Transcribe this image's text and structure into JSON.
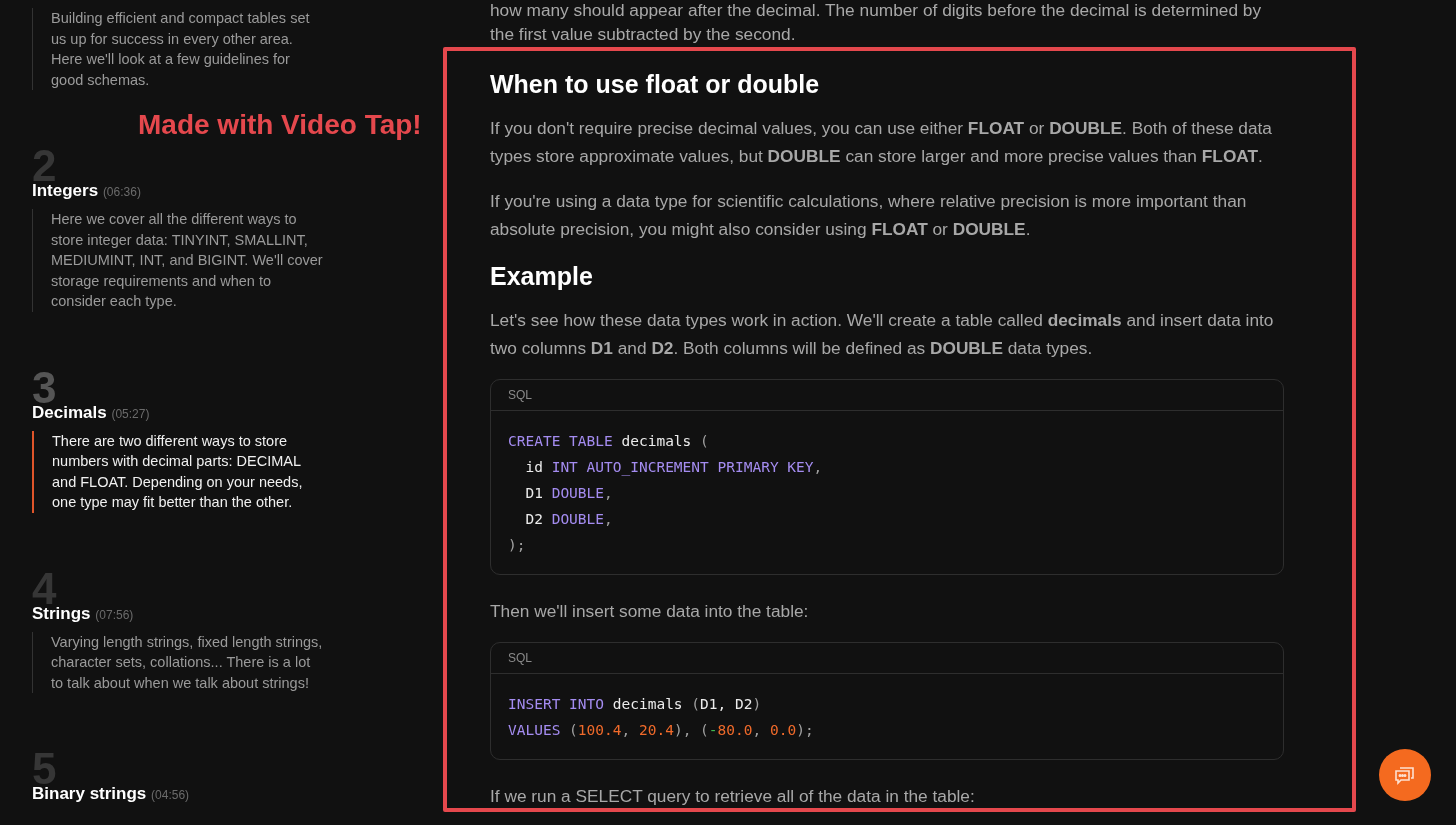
{
  "chapters": [
    {
      "description": "Building efficient and compact tables set us up for success in every other area. Here we'll look at a few guidelines for good schemas.",
      "selected": false
    },
    {
      "number": "2",
      "title": "Integers",
      "time": "(06:36)",
      "description": "Here we cover all the different ways to store integer data: TINYINT, SMALLINT, MEDIUMINT, INT, and BIGINT. We'll cover storage requirements and when to consider each type.",
      "selected": false
    },
    {
      "number": "3",
      "title": "Decimals",
      "time": "(05:27)",
      "description": "There are two different ways to store numbers with decimal parts: DECIMAL and FLOAT. Depending on your needs, one type may fit better than the other.",
      "selected": true
    },
    {
      "number": "4",
      "title": "Strings",
      "time": "(07:56)",
      "description": "Varying length strings, fixed length strings, character sets, collations... There is a lot to talk about when we talk about strings!",
      "selected": false
    },
    {
      "number": "5",
      "title": "Binary strings",
      "time": "(04:56)",
      "selected": false
    }
  ],
  "article": [
    {
      "kind": "paragraph",
      "text": "how many should appear after the decimal. The number of digits before the decimal is determined by the first value subtracted by the second."
    },
    {
      "kind": "heading",
      "text": "When to use float or double"
    },
    {
      "kind": "paragraph",
      "text": "If you don't require precise decimal values, you can use either **FLOAT** or **DOUBLE**. Both of these data types store approximate values, but **DOUBLE** can store larger and more precise values than **FLOAT**."
    },
    {
      "kind": "paragraph",
      "text": "If you're using a data type for scientific calculations, where relative precision is more important than absolute precision, you might also consider using **FLOAT** or **DOUBLE**."
    },
    {
      "kind": "heading",
      "text": "Example"
    },
    {
      "kind": "paragraph",
      "text": "Let's see how these data types work in action. We'll create a table called **decimals** and insert data into two columns **D1** and **D2**. Both columns will be defined as **DOUBLE** data types."
    },
    {
      "kind": "code",
      "language": "SQL",
      "lines": [
        [
          {
            "kind": "keyword",
            "text": "CREATE TABLE"
          },
          {
            "kind": "plain",
            "text": " decimals "
          },
          {
            "kind": "punct",
            "text": "("
          }
        ],
        [
          {
            "kind": "plain",
            "text": "  id "
          },
          {
            "kind": "keyword",
            "text": "INT AUTO_INCREMENT PRIMARY KEY"
          },
          {
            "kind": "punct",
            "text": ","
          }
        ],
        [
          {
            "kind": "plain",
            "text": "  D1 "
          },
          {
            "kind": "keyword",
            "text": "DOUBLE"
          },
          {
            "kind": "punct",
            "text": ","
          }
        ],
        [
          {
            "kind": "plain",
            "text": "  D2 "
          },
          {
            "kind": "keyword",
            "text": "DOUBLE"
          },
          {
            "kind": "punct",
            "text": ","
          }
        ],
        [
          {
            "kind": "punct",
            "text": ");"
          }
        ]
      ]
    },
    {
      "kind": "paragraph",
      "text": "Then we'll insert some data into the table:"
    },
    {
      "kind": "code",
      "language": "SQL",
      "lines": [
        [
          {
            "kind": "keyword",
            "text": "INSERT INTO"
          },
          {
            "kind": "plain",
            "text": " decimals "
          },
          {
            "kind": "punct",
            "text": "("
          },
          {
            "kind": "plain",
            "text": "D1, D2"
          },
          {
            "kind": "punct",
            "text": ")"
          }
        ],
        [
          {
            "kind": "keyword",
            "text": "VALUES"
          },
          {
            "kind": "punct",
            "text": " ("
          },
          {
            "kind": "number",
            "text": "100.4"
          },
          {
            "kind": "punct",
            "text": ", "
          },
          {
            "kind": "number",
            "text": "20.4"
          },
          {
            "kind": "punct",
            "text": "), ("
          },
          {
            "kind": "operator",
            "text": "-"
          },
          {
            "kind": "number",
            "text": "80.0"
          },
          {
            "kind": "punct",
            "text": ", "
          },
          {
            "kind": "number",
            "text": "0.0"
          },
          {
            "kind": "punct",
            "text": ");"
          }
        ]
      ]
    },
    {
      "kind": "paragraph",
      "text": "If we run a SELECT query to retrieve all of the data in the table:"
    }
  ],
  "annotation": {
    "caption": "Made with Video Tap!"
  }
}
